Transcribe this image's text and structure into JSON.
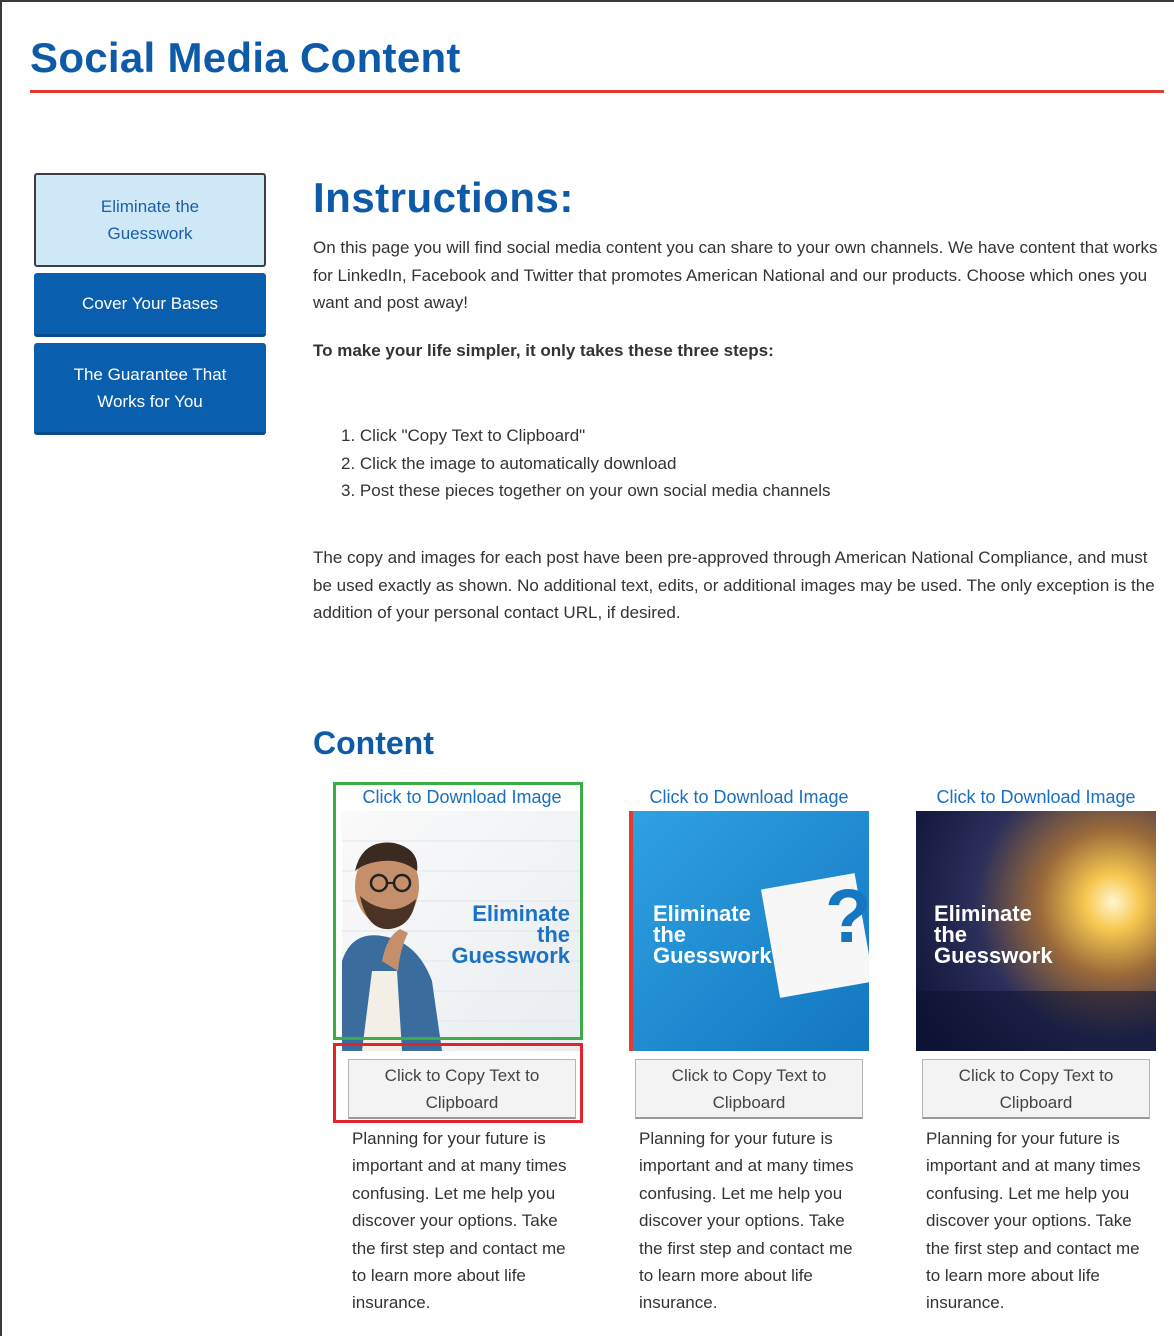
{
  "page": {
    "title": "Social Media Content"
  },
  "nav": {
    "items": [
      {
        "label": "Eliminate the Guesswork",
        "active": true
      },
      {
        "label": "Cover Your Bases",
        "active": false
      },
      {
        "label": "The Guarantee That Works for You",
        "active": false
      }
    ]
  },
  "instructions": {
    "heading": "Instructions:",
    "intro": "On this page you will find social media content you can share to your own channels. We have content that works for LinkedIn, Facebook and Twitter that promotes American National and our products. Choose which ones you want and post away!",
    "steps_intro": "To make your life simpler, it only takes these three steps:",
    "steps": [
      "1. Click \"Copy Text to Clipboard\"",
      "2. Click the image to automatically download",
      "3. Post these pieces together on your own social media channels"
    ],
    "compliance": "The copy and images for each post have been pre-approved through American National Compliance, and must be used exactly as shown. No additional text, edits, or additional images may be used. The only exception is the addition of your personal contact URL, if desired."
  },
  "content": {
    "heading": "Content",
    "cards": [
      {
        "download_label": "Click to Download Image",
        "image_lines": [
          "Eliminate",
          "the",
          "Guesswork"
        ],
        "copy_label": "Click to Copy Text to Clipboard",
        "text": "Planning for your future is important and at many times confusing. Let me help you discover your options. Take the first step and contact me to learn more about life insurance."
      },
      {
        "download_label": "Click to Download Image",
        "image_lines": [
          "Eliminate",
          "the",
          "Guesswork"
        ],
        "image_symbol": "?",
        "copy_label": "Click to Copy Text to Clipboard",
        "text": "Planning for your future is important and at many times confusing. Let me help you discover your options. Take the first step and contact me to learn more about life insurance."
      },
      {
        "download_label": "Click to Download Image",
        "image_lines": [
          "Eliminate",
          "the",
          "Guesswork"
        ],
        "copy_label": "Click to Copy Text to Clipboard",
        "text": "Planning for your future is important and at many times confusing. Let me help you discover your options. Take the first step and contact me to learn more about life insurance."
      }
    ]
  },
  "colors": {
    "brand_blue": "#0d5aa8",
    "accent_red": "#e23b32",
    "highlight_green": "#3aad45",
    "highlight_red": "#e0242a"
  }
}
